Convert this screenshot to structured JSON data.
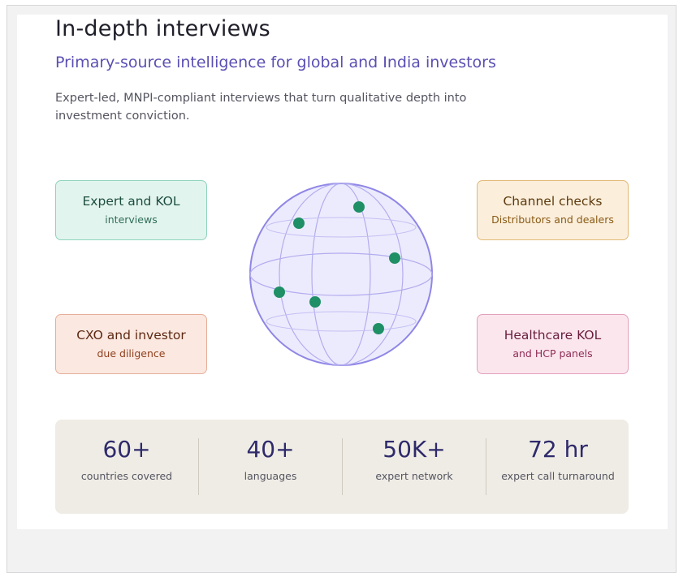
{
  "header": {
    "title": "In-depth interviews",
    "subtitle": "Primary-source intelligence for global and India investors",
    "description": "Expert-led, MNPI-compliant interviews that turn qualitative depth into investment conviction."
  },
  "boxes": {
    "expert": {
      "title": "Expert and KOL",
      "subtitle": "interviews"
    },
    "channel": {
      "title": "Channel checks",
      "subtitle": "Distributors and dealers"
    },
    "cxo": {
      "title": "CXO and investor",
      "subtitle": "due diligence"
    },
    "healthcare": {
      "title": "Healthcare KOL",
      "subtitle": "and HCP panels"
    }
  },
  "stats": [
    {
      "value": "60+",
      "label": "countries covered"
    },
    {
      "value": "40+",
      "label": "languages"
    },
    {
      "value": "50K+",
      "label": "expert network"
    },
    {
      "value": "72 hr",
      "label": "expert call turnaround"
    }
  ],
  "colors": {
    "accent": "#5a4fb3",
    "globe_stroke": "#8f86e6",
    "globe_fill": "#ecebfd",
    "marker": "#1f8f66"
  }
}
